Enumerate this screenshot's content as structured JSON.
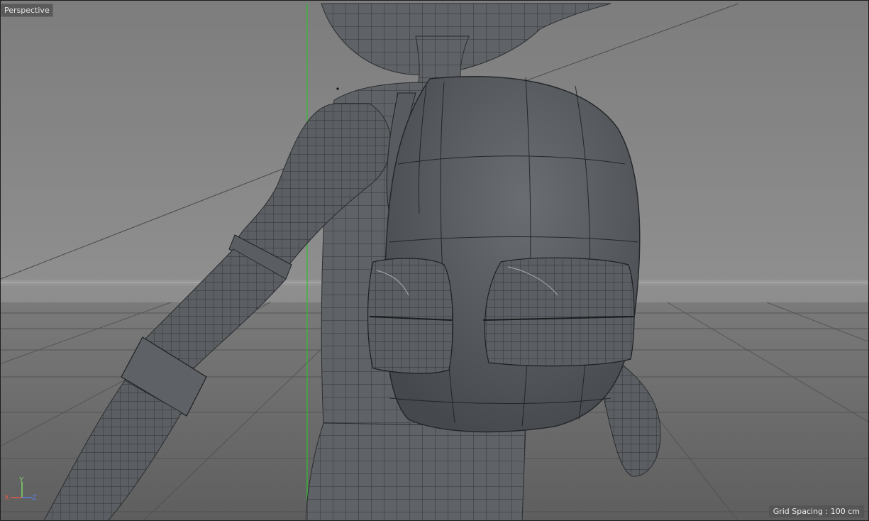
{
  "viewport": {
    "camera_label": "Perspective",
    "grid_spacing_label": "Grid Spacing : 100 cm"
  },
  "axis_gizmo": {
    "y_label": "Y",
    "x_label": "X",
    "z_label": "Z",
    "colors": {
      "y": "#7ed36a",
      "x": "#e05a4a",
      "z": "#5a7ee0"
    }
  },
  "scene": {
    "model_fill": "#5f6266",
    "wire_color": "#1c1e20",
    "floor_color": "#6e6e6e",
    "horizon_color": "#a0a0a0",
    "y_axis_line_color": "#2fbf2f"
  }
}
